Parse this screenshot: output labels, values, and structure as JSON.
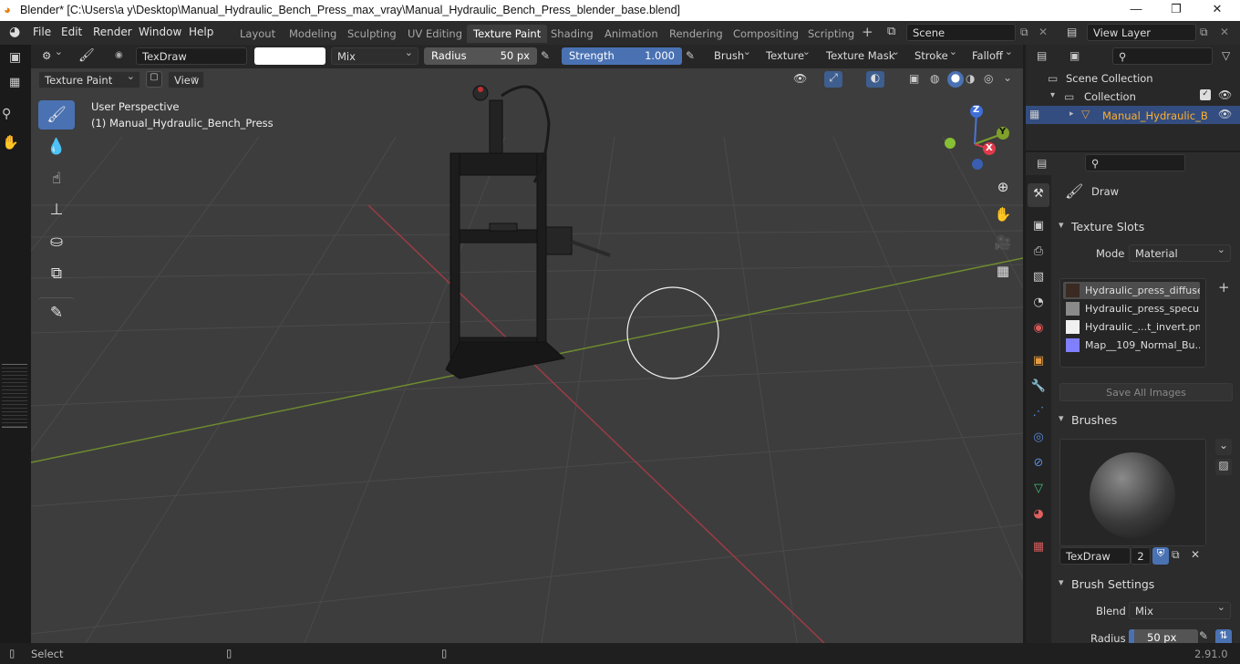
{
  "window": {
    "title": "Blender* [C:\\Users\\a y\\Desktop\\Manual_Hydraulic_Bench_Press_max_vray\\Manual_Hydraulic_Bench_Press_blender_base.blend]",
    "minimize": "—",
    "maximize": "❐",
    "close": "✕"
  },
  "menus": [
    "File",
    "Edit",
    "Render",
    "Window",
    "Help"
  ],
  "workspaces": [
    "Layout",
    "Modeling",
    "Sculpting",
    "UV Editing",
    "Texture Paint",
    "Shading",
    "Animation",
    "Rendering",
    "Compositing",
    "Scripting"
  ],
  "active_workspace": "Texture Paint",
  "scene": {
    "label": "Scene",
    "view_layer": "View Layer"
  },
  "tool_header": {
    "brush_name": "TexDraw",
    "blend_mode": "Mix",
    "radius_label": "Radius",
    "radius_value": "50 px",
    "strength_label": "Strength",
    "strength_value": "1.000",
    "dropdowns": [
      "Brush",
      "Texture",
      "Texture Mask",
      "Stroke",
      "Falloff"
    ]
  },
  "viewport_header": {
    "mode": "Texture Paint",
    "view": "View"
  },
  "viewport": {
    "perspective": "User Perspective",
    "object": "(1) Manual_Hydraulic_Bench_Press",
    "gizmo": {
      "z": "Z",
      "y": "Y",
      "x": "X"
    },
    "colors": {
      "bg": "#3d3d3d",
      "grid": "#4a4a4a",
      "x_axis": "#9c3b45",
      "y_axis": "#6e8a2f"
    }
  },
  "tools": [
    "draw-icon",
    "soften-icon",
    "smear-icon",
    "clone-icon",
    "fill-icon",
    "mask-icon",
    "annotate-icon"
  ],
  "outliner": {
    "scene_collection": "Scene Collection",
    "collection": "Collection",
    "object": "Manual_Hydraulic_B"
  },
  "properties": {
    "active_tool": "Draw",
    "texture_slots": {
      "title": "Texture Slots",
      "mode_label": "Mode",
      "mode_value": "Material",
      "slots": [
        {
          "name": "Hydraulic_press_diffuse...",
          "color": "#3a2a22"
        },
        {
          "name": "Hydraulic_press_specul...",
          "color": "#8a8a8a"
        },
        {
          "name": "Hydraulic_...t_invert.png",
          "color": "#f0f0f0"
        },
        {
          "name": "Map__109_Normal_Bu...",
          "color": "#7f7fff"
        }
      ],
      "save_all": "Save All Images"
    },
    "brushes": {
      "title": "Brushes",
      "name": "TexDraw",
      "users": "2"
    },
    "brush_settings": {
      "title": "Brush Settings",
      "blend_label": "Blend",
      "blend_value": "Mix",
      "radius_label": "Radius",
      "radius_value": "50 px"
    }
  },
  "status": {
    "left": "Select",
    "version": "2.91.0"
  }
}
